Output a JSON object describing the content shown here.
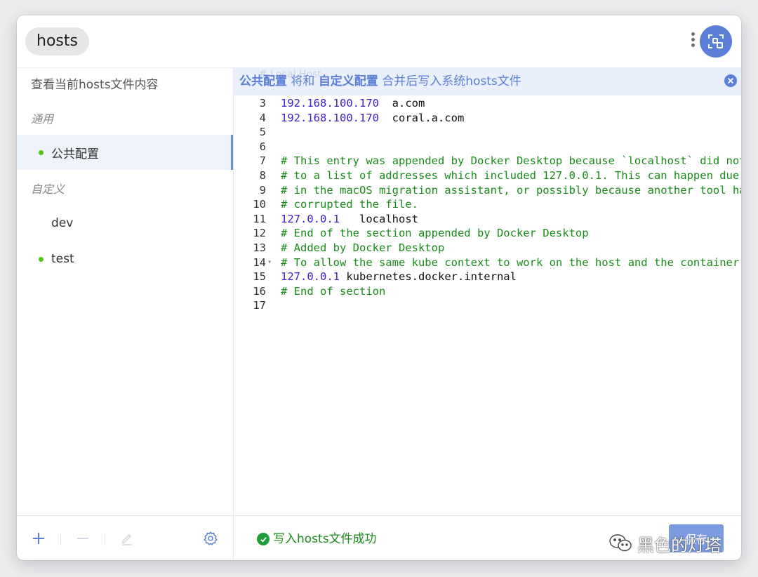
{
  "app": {
    "title": "hosts"
  },
  "sidebar": {
    "view_current": "查看当前hosts文件内容",
    "groups": {
      "common": "通用",
      "custom": "自定义"
    },
    "items": [
      {
        "label": "公共配置",
        "enabled": true,
        "active": true
      },
      {
        "label": "dev",
        "enabled": false,
        "active": false
      },
      {
        "label": "test",
        "enabled": true,
        "active": false
      }
    ]
  },
  "notice": {
    "ghost": "# Local Host",
    "part1": "公共配置",
    "part2": " 将和 ",
    "part3": "自定义配置",
    "part4": " 合并后写入系统hosts文件"
  },
  "editor": {
    "lines": [
      {
        "n": "3",
        "kind": "host",
        "ip": "192.168.100.170",
        "sep": "  ",
        "host": "a.com"
      },
      {
        "n": "4",
        "kind": "host",
        "ip": "192.168.100.170",
        "sep": "  ",
        "host": "coral.a.com"
      },
      {
        "n": "5",
        "kind": "blank"
      },
      {
        "n": "6",
        "kind": "blank"
      },
      {
        "n": "7",
        "kind": "comment",
        "text": "# This entry was appended by Docker Desktop because `localhost` did not"
      },
      {
        "n": "8",
        "kind": "comment",
        "text": "# to a list of addresses which included 127.0.0.1. This can happen due"
      },
      {
        "n": "9",
        "kind": "comment",
        "text": "# in the macOS migration assistant, or possibly because another tool ha"
      },
      {
        "n": "10",
        "kind": "comment",
        "text": "# corrupted the file."
      },
      {
        "n": "11",
        "kind": "host",
        "ip": "127.0.0.1",
        "sep": "   ",
        "host": "localhost"
      },
      {
        "n": "12",
        "kind": "comment",
        "text": "# End of the section appended by Docker Desktop"
      },
      {
        "n": "13",
        "kind": "comment",
        "text": "# Added by Docker Desktop"
      },
      {
        "n": "14",
        "kind": "comment",
        "fold": true,
        "text": "# To allow the same kube context to work on the host and the container:"
      },
      {
        "n": "15",
        "kind": "host",
        "ip": "127.0.0.1",
        "sep": " ",
        "host": "kubernetes.docker.internal"
      },
      {
        "n": "16",
        "kind": "comment",
        "text": "# End of section"
      },
      {
        "n": "17",
        "kind": "blank"
      }
    ]
  },
  "footer": {
    "status": "写入hosts文件成功",
    "save_label": "保存"
  },
  "watermark": {
    "text": "黑色的灯塔"
  },
  "colors": {
    "accent": "#5b7fd6",
    "success": "#1a8b1a",
    "ip": "#3b22c9",
    "comment": "#1a8b1a"
  }
}
